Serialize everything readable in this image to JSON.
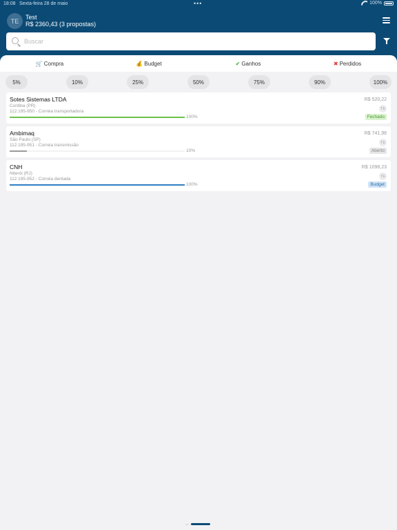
{
  "status_bar": {
    "time": "18:08",
    "date": "Sexta-feira 28 de maio",
    "battery": "100%"
  },
  "user": {
    "initials": "TE",
    "name": "Test",
    "total": "R$ 2360,43 (3 propostas)"
  },
  "search": {
    "placeholder": "Buscar",
    "value": ""
  },
  "tabs": [
    {
      "emoji": "🛒",
      "label": "Compra"
    },
    {
      "emoji": "💰",
      "label": "Budget"
    },
    {
      "emoji": "✔",
      "label": "Ganhos",
      "color": "#3aa832"
    },
    {
      "emoji": "✖",
      "label": "Perdidos",
      "color": "#e53935"
    }
  ],
  "percent_filters": [
    "5%",
    "10%",
    "25%",
    "50%",
    "75%",
    "90%",
    "100%"
  ],
  "proposals": [
    {
      "company": "Sotes Sistemas LTDA",
      "city": "Curitiba (PR)",
      "ref": "112.195-950 - Correia transportadora",
      "progress": 1.0,
      "progress_label": "100%",
      "progress_color": "#6cc24a",
      "value": "R$ 520,22",
      "initials": "TE",
      "status": "Fechado",
      "status_bg": "#d9f2cf",
      "status_color": "#4a9a2c"
    },
    {
      "company": "Ambimaq",
      "city": "São Paulo (SP)",
      "ref": "112.195-951 - Correia transmissão",
      "progress": 0.1,
      "progress_label": "10%",
      "progress_color": "#9a9a9a",
      "value": "R$ 741,98",
      "initials": "TE",
      "status": "Aberto",
      "status_bg": "#e6e6e6",
      "status_color": "#888888"
    },
    {
      "company": "CNH",
      "city": "Niterói (RJ)",
      "ref": "112.195-952 - Correia dentada",
      "progress": 1.0,
      "progress_label": "100%",
      "progress_color": "#2f7ec1",
      "value": "R$ 1098,23",
      "initials": "TE",
      "status": "Budget",
      "status_bg": "#cfe3f6",
      "status_color": "#2f6fa8"
    }
  ]
}
